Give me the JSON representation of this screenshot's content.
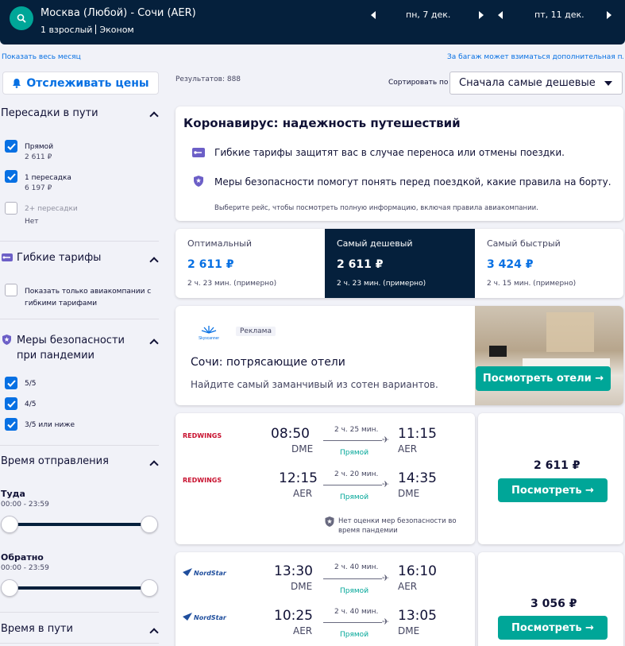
{
  "header": {
    "route": "Москва (Любой) - Сочи (AER)",
    "passengers": "1 взрослый",
    "cabin": "Эконом",
    "date_out": "пн, 7 дек.",
    "date_back": "пт, 11 дек."
  },
  "links": {
    "show_month": "Показать весь месяц",
    "baggage_note": "За багаж может взиматься дополнительная плата"
  },
  "track_button": "Отслеживать цены",
  "results_count": "Результатов: 888",
  "sort": {
    "label": "Сортировать по",
    "value": "Сначала самые дешевые"
  },
  "filters": {
    "stops": {
      "title": "Пересадки в пути",
      "options": [
        {
          "label": "Прямой",
          "price": "2 611 ₽",
          "checked": true
        },
        {
          "label": "1 пересадка",
          "price": "6 197 ₽",
          "checked": true
        },
        {
          "label": "2+ пересадки",
          "price": "Нет",
          "checked": false
        }
      ]
    },
    "flexible": {
      "title": "Гибкие тарифы",
      "option": "Показать только авиакомпании с гибкими тарифами"
    },
    "safety": {
      "title": "Меры безопасности при пандемии",
      "options": [
        "5/5",
        "4/5",
        "3/5 или ниже"
      ]
    },
    "departure": {
      "title": "Время отправления",
      "out_label": "Туда",
      "out_range": "00:00 - 23:59",
      "back_label": "Обратно",
      "back_range": "00:00 - 23:59"
    },
    "duration": {
      "title": "Время в пути"
    }
  },
  "covid": {
    "title": "Коронавирус: надежность путешествий",
    "line1": "Гибкие тарифы защитят вас в случае переноса или отмены поездки.",
    "line2": "Меры безопасности помогут понять перед поездкой, какие правила на борту.",
    "note": "Выберите рейс, чтобы посмотреть полную информацию, включая правила авиакомпании."
  },
  "tabs": [
    {
      "label": "Оптимальный",
      "price": "2 611 ₽",
      "duration": "2 ч. 23 мин. (примерно)"
    },
    {
      "label": "Самый дешевый",
      "price": "2 611 ₽",
      "duration": "2 ч. 23 мин. (примерно)"
    },
    {
      "label": "Самый быстрый",
      "price": "3 424 ₽",
      "duration": "2 ч. 15 мин. (примерно)"
    }
  ],
  "ad": {
    "brand": "Skyscanner",
    "tag": "Реклама",
    "title": "Сочи: потрясающие отели",
    "subtitle": "Найдите самый заманчивый из сотен вариантов.",
    "button": "Посмотреть отели →"
  },
  "flights": [
    {
      "airline": "REDWINGS",
      "legs": [
        {
          "dep": "08:50",
          "from": "DME",
          "duration": "2 ч. 25 мин.",
          "stops": "Прямой",
          "arr": "11:15",
          "to": "AER"
        },
        {
          "dep": "12:15",
          "from": "AER",
          "duration": "2 ч. 20 мин.",
          "stops": "Прямой",
          "arr": "14:35",
          "to": "DME"
        }
      ],
      "note": "Нет оценки мер безопасности во время пандемии",
      "price": "2 611 ₽",
      "button": "Посмотреть →"
    },
    {
      "airline": "NordStar",
      "legs": [
        {
          "dep": "13:30",
          "from": "DME",
          "duration": "2 ч. 40 мин.",
          "stops": "Прямой",
          "arr": "16:10",
          "to": "AER"
        },
        {
          "dep": "10:25",
          "from": "AER",
          "duration": "2 ч. 40 мин.",
          "stops": "Прямой",
          "arr": "13:05",
          "to": "DME"
        }
      ],
      "price": "3 056 ₽",
      "button": "Посмотреть →"
    }
  ],
  "colors": {
    "header_bg": "#05203c",
    "accent_blue": "#0770e3",
    "accent_green": "#00a698",
    "selected_tab": "#05203c"
  }
}
